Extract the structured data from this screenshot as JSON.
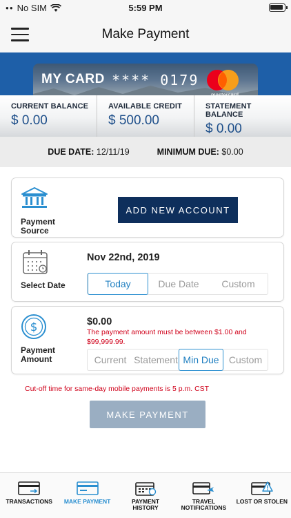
{
  "status_bar": {
    "carrier": "No SIM",
    "time": "5:59 PM"
  },
  "header": {
    "title": "Make Payment"
  },
  "card": {
    "name": "MY CARD",
    "masked_number": "**** 0179",
    "network": "mastercard"
  },
  "balances": [
    {
      "label": "CURRENT BALANCE",
      "value": "$ 0.00"
    },
    {
      "label": "AVAILABLE CREDIT",
      "value": "$ 500.00"
    },
    {
      "label": "STATEMENT BALANCE",
      "value": "$ 0.00"
    }
  ],
  "due": {
    "due_label": "DUE DATE:",
    "due_value": "12/11/19",
    "min_label": "MINIMUM DUE:",
    "min_value": "$0.00"
  },
  "payment_source": {
    "caption": "Payment Source",
    "button_label": "ADD NEW ACCOUNT"
  },
  "select_date": {
    "caption": "Select Date",
    "value": "Nov 22nd, 2019",
    "options": [
      "Today",
      "Due Date",
      "Custom"
    ],
    "selected": "Today"
  },
  "payment_amount": {
    "caption": "Payment Amount",
    "value": "$0.00",
    "error": "The payment amount must be between $1.00 and $99,999.99.",
    "options": [
      "Current",
      "Statement",
      "Min Due",
      "Custom"
    ],
    "selected": "Min Due"
  },
  "cutoff_note": "Cut-off time for same-day mobile payments is 5 p.m. CST",
  "make_payment_button": "MAKE PAYMENT",
  "tabs": [
    {
      "label_line1": "TRANSACTIONS",
      "label_line2": "",
      "icon": "card-swipe-icon"
    },
    {
      "label_line1": "MAKE PAYMENT",
      "label_line2": "",
      "icon": "card-payment-icon",
      "active": true
    },
    {
      "label_line1": "PAYMENT",
      "label_line2": "HISTORY",
      "icon": "calendar-history-icon"
    },
    {
      "label_line1": "TRAVEL",
      "label_line2": "NOTIFICATIONS",
      "icon": "card-travel-icon"
    },
    {
      "label_line1": "LOST OR STOLEN",
      "label_line2": "",
      "icon": "card-alert-icon"
    }
  ],
  "colors": {
    "accent": "#2b8fd0",
    "navy_button": "#0e2f5c",
    "banner": "#1e5fa8",
    "error": "#d0021b",
    "disabled_button": "#9aaec2"
  }
}
